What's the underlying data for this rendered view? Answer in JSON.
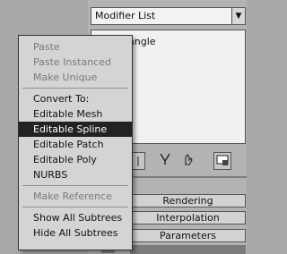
{
  "modifier_panel": {
    "modifier_list_label": "Modifier List",
    "dropdown_arrow": "▼",
    "stack_item_partial": "angle"
  },
  "toolbar": {
    "pin_label": "|",
    "fork_icon": "fork-icon",
    "lock_icon": "hand-icon",
    "config_icon": "configure-icon"
  },
  "rollouts": {
    "rendering": "Rendering",
    "interpolation": "Interpolation",
    "parameters": "Parameters"
  },
  "context_menu": {
    "items": [
      {
        "label": "Paste",
        "enabled": false
      },
      {
        "label": "Paste Instanced",
        "enabled": false
      },
      {
        "label": "Make Unique",
        "enabled": false
      },
      {
        "label": "Convert To:",
        "enabled": true
      },
      {
        "label": "Editable Mesh",
        "enabled": true
      },
      {
        "label": "Editable Spline",
        "enabled": true,
        "highlighted": true
      },
      {
        "label": "Editable Patch",
        "enabled": true
      },
      {
        "label": "Editable Poly",
        "enabled": true
      },
      {
        "label": "NURBS",
        "enabled": true
      },
      {
        "label": "Make Reference",
        "enabled": false
      },
      {
        "label": "Show All Subtrees",
        "enabled": true
      },
      {
        "label": "Hide All Subtrees",
        "enabled": true
      }
    ]
  }
}
